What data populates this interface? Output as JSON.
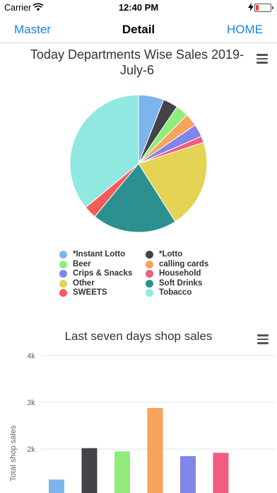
{
  "status_bar": {
    "carrier": "Carrier",
    "time": "12:40 PM"
  },
  "nav": {
    "left_label": "Master",
    "title": "Detail",
    "right_label": "HOME"
  },
  "pie_chart": {
    "menu_icon": "hamburger-menu-icon",
    "chart_data": {
      "type": "pie",
      "title": "Today Departments Wise Sales 2019-July-6",
      "slices": [
        {
          "label": "*Instant Lotto",
          "value": 6.0,
          "color": "#7cb5ec"
        },
        {
          "label": "*Lotto",
          "value": 3.5,
          "color": "#434348"
        },
        {
          "label": "Beer",
          "value": 3.0,
          "color": "#90ed7d"
        },
        {
          "label": "calling cards",
          "value": 3.0,
          "color": "#f7a35c"
        },
        {
          "label": "Crips & Snacks",
          "value": 3.0,
          "color": "#8085e9"
        },
        {
          "label": "Household",
          "value": 1.5,
          "color": "#f15c80"
        },
        {
          "label": "Other",
          "value": 21.0,
          "color": "#e4d354"
        },
        {
          "label": "Soft Drinks",
          "value": 20.0,
          "color": "#2b908f"
        },
        {
          "label": "SWEETS",
          "value": 3.0,
          "color": "#f45b5b"
        },
        {
          "label": "Tobacco",
          "value": 36.0,
          "color": "#91e8e1"
        }
      ]
    }
  },
  "bar_chart": {
    "menu_icon": "hamburger-menu-icon",
    "chart_data": {
      "type": "bar",
      "title": "Last seven days shop sales",
      "ylabel": "Total shop sales",
      "yticks": [
        "4k",
        "3k",
        "2k"
      ],
      "ylim": [
        1000,
        4000
      ],
      "values": [
        1350,
        2020,
        1950,
        2880,
        1850,
        1920
      ],
      "colors": [
        "#7cb5ec",
        "#434348",
        "#90ed7d",
        "#f7a35c",
        "#8085e9",
        "#f15c80"
      ]
    }
  }
}
